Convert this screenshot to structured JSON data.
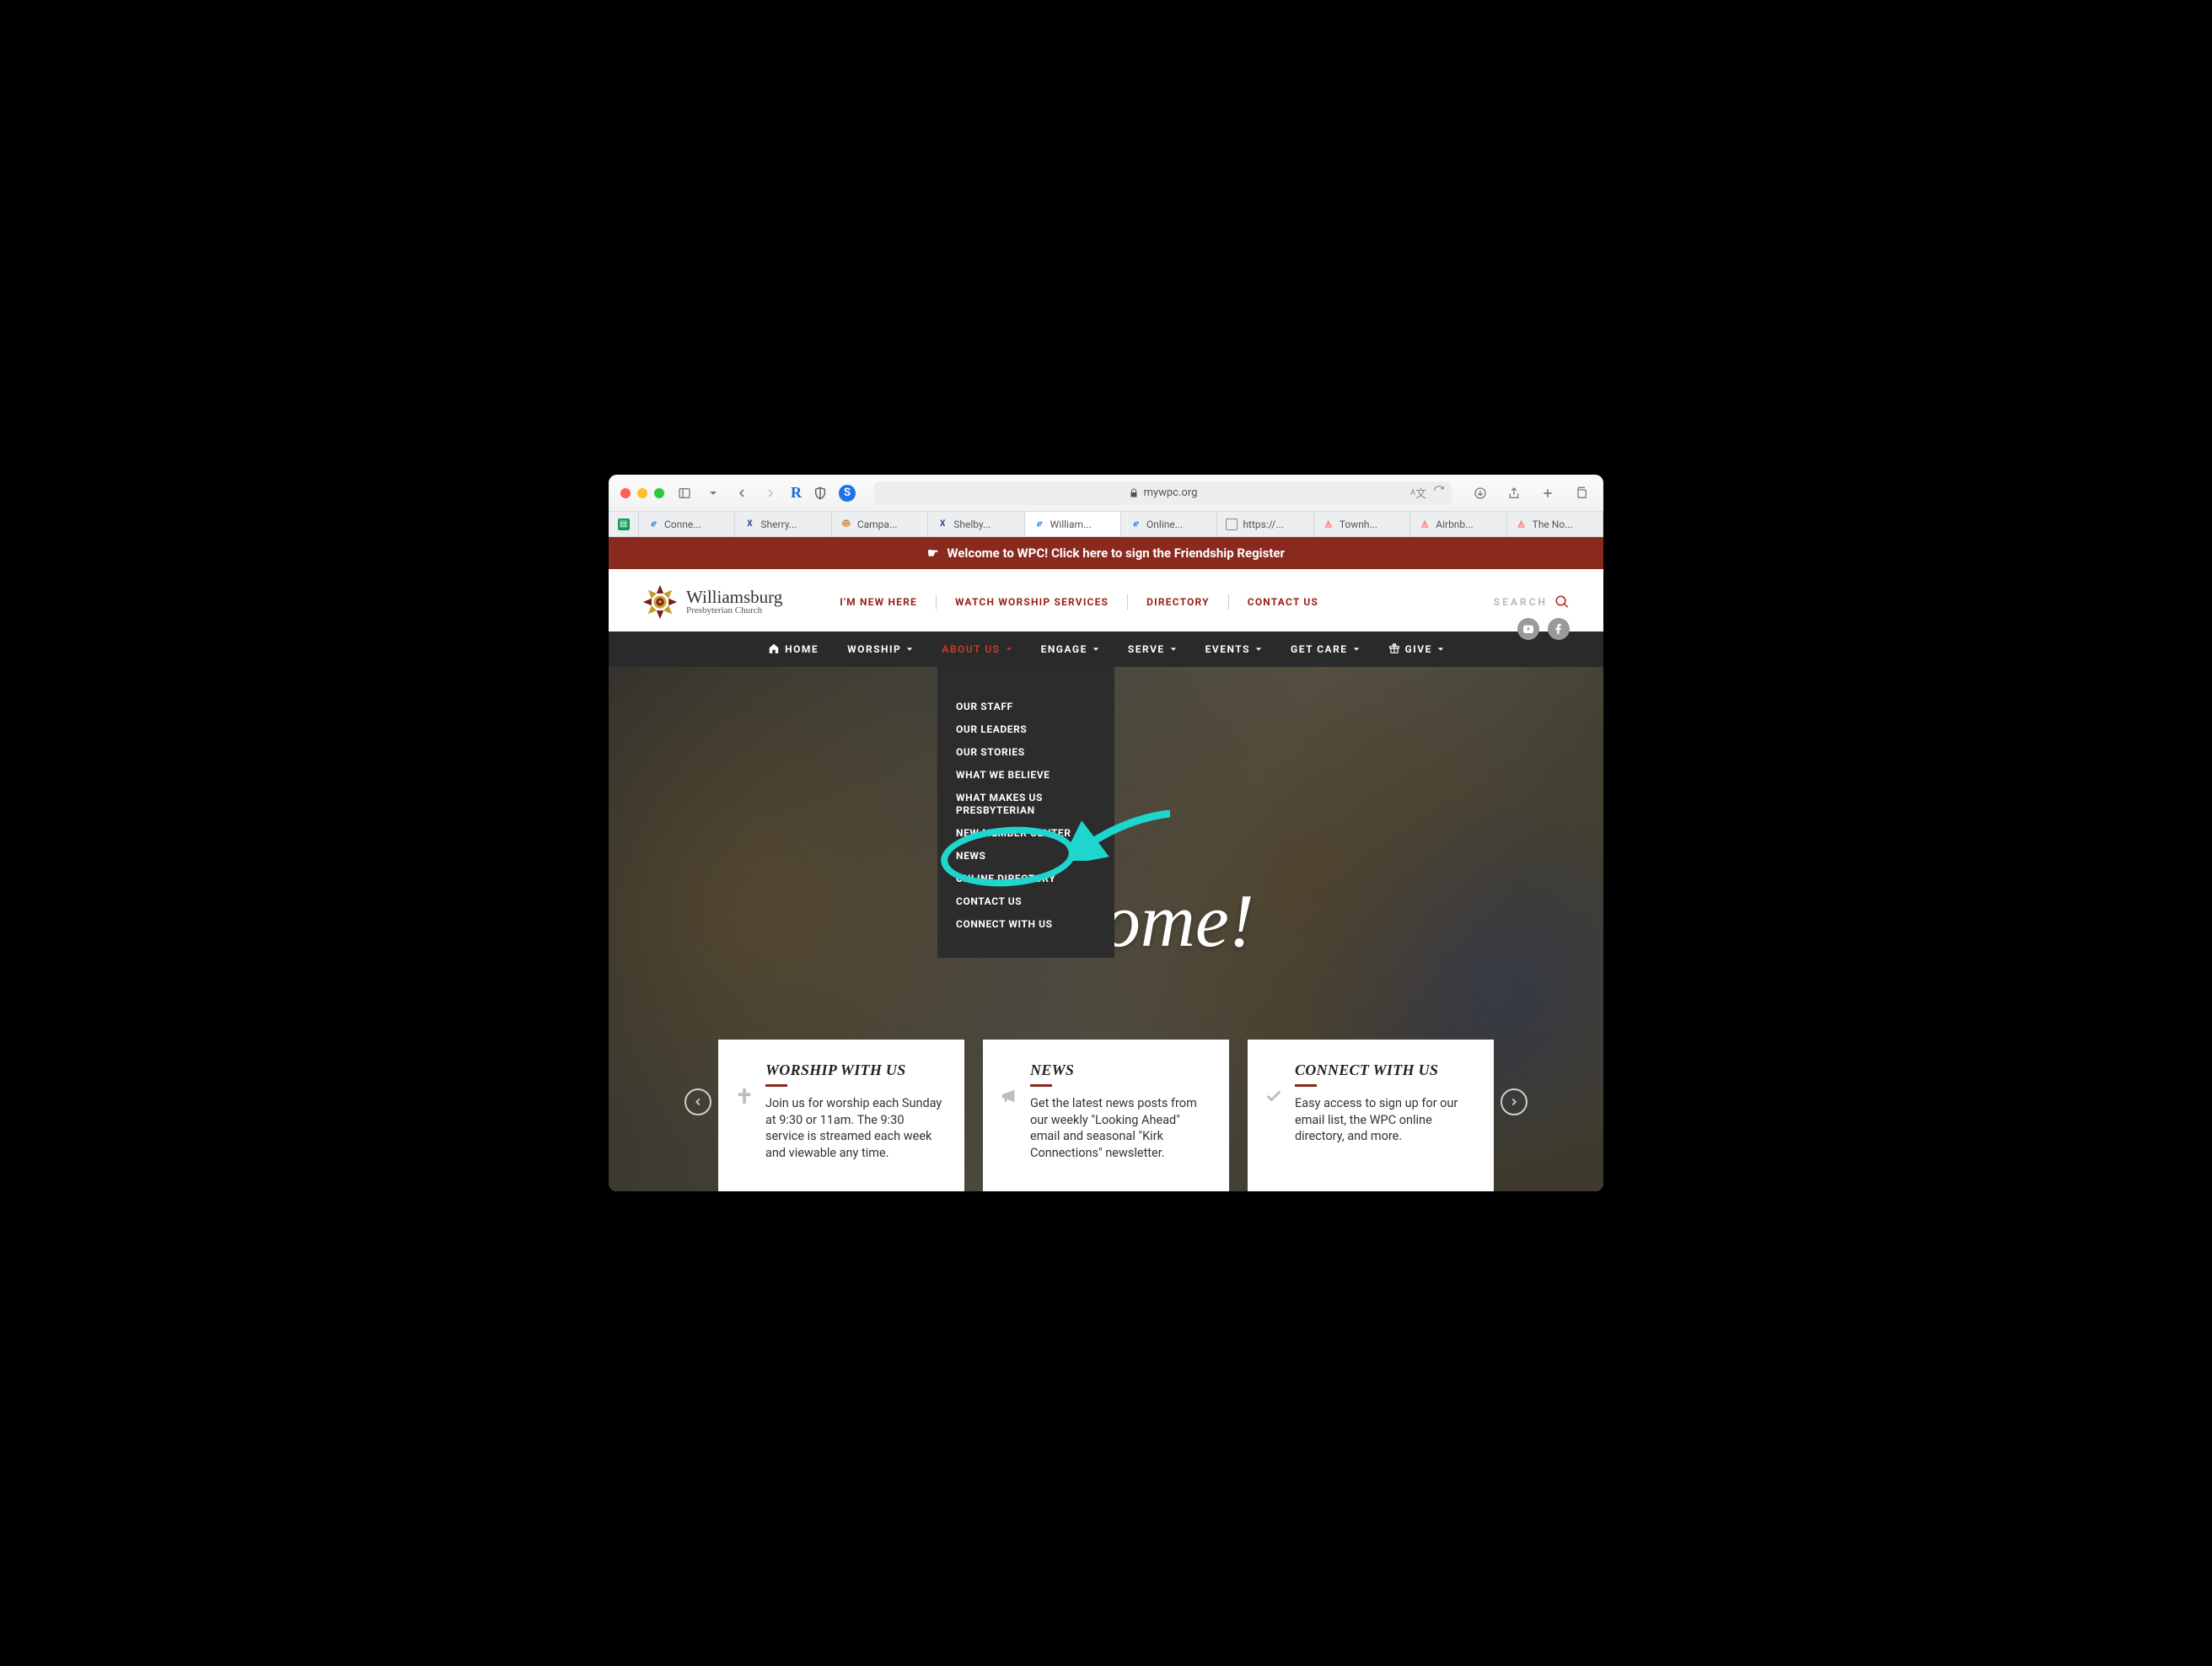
{
  "browser": {
    "url_host": "mywpc.org",
    "tabs": [
      {
        "icon": "sheets",
        "label": ""
      },
      {
        "icon": "e",
        "label": "Conne..."
      },
      {
        "icon": "x",
        "label": "Sherry..."
      },
      {
        "icon": "mc",
        "label": "Campa..."
      },
      {
        "icon": "x",
        "label": "Shelby..."
      },
      {
        "icon": "e",
        "label": "William...",
        "active": true
      },
      {
        "icon": "e",
        "label": "Online..."
      },
      {
        "icon": "doc",
        "label": "https://..."
      },
      {
        "icon": "air",
        "label": "Townh..."
      },
      {
        "icon": "air",
        "label": "Airbnb..."
      },
      {
        "icon": "air",
        "label": "The No..."
      }
    ]
  },
  "banner": {
    "text": "Welcome to WPC! Click here to sign the Friendship Register"
  },
  "logo": {
    "line1": "Williamsburg",
    "line2": "Presbyterian Church"
  },
  "topnav": {
    "items": [
      "I'M NEW HERE",
      "WATCH WORSHIP SERVICES",
      "DIRECTORY",
      "CONTACT US"
    ],
    "search_placeholder": "SEARCH"
  },
  "mainnav": {
    "items": [
      {
        "label": "HOME",
        "icon": "home",
        "hasCaret": false,
        "active": false
      },
      {
        "label": "WORSHIP",
        "hasCaret": true,
        "active": false
      },
      {
        "label": "ABOUT US",
        "hasCaret": true,
        "active": true
      },
      {
        "label": "ENGAGE",
        "hasCaret": true,
        "active": false
      },
      {
        "label": "SERVE",
        "hasCaret": true,
        "active": false
      },
      {
        "label": "EVENTS",
        "hasCaret": true,
        "active": false
      },
      {
        "label": "GET CARE",
        "hasCaret": true,
        "active": false
      },
      {
        "label": "GIVE",
        "icon": "gift",
        "hasCaret": true,
        "active": false
      }
    ]
  },
  "dropdown": {
    "items": [
      "OUR STAFF",
      "OUR LEADERS",
      "OUR STORIES",
      "WHAT WE BELIEVE",
      "WHAT MAKES US PRESBYTERIAN",
      "NEW MEMBER CENTER",
      "NEWS",
      "ONLINE DIRECTORY",
      "CONTACT US",
      "CONNECT WITH US"
    ]
  },
  "hero": {
    "title": "Welcome!"
  },
  "cards": [
    {
      "title": "WORSHIP WITH US",
      "icon": "cross",
      "body": "Join us for worship each Sunday at 9:30 or 11am. The 9:30 service is streamed each week and viewable any time."
    },
    {
      "title": "NEWS",
      "icon": "megaphone",
      "body": "Get the latest news posts from our weekly \"Looking Ahead\" email and seasonal \"Kirk Connections\" newsletter."
    },
    {
      "title": "CONNECT WITH US",
      "icon": "check",
      "body": "Easy access to sign up for our email list, the WPC online directory, and more."
    }
  ]
}
